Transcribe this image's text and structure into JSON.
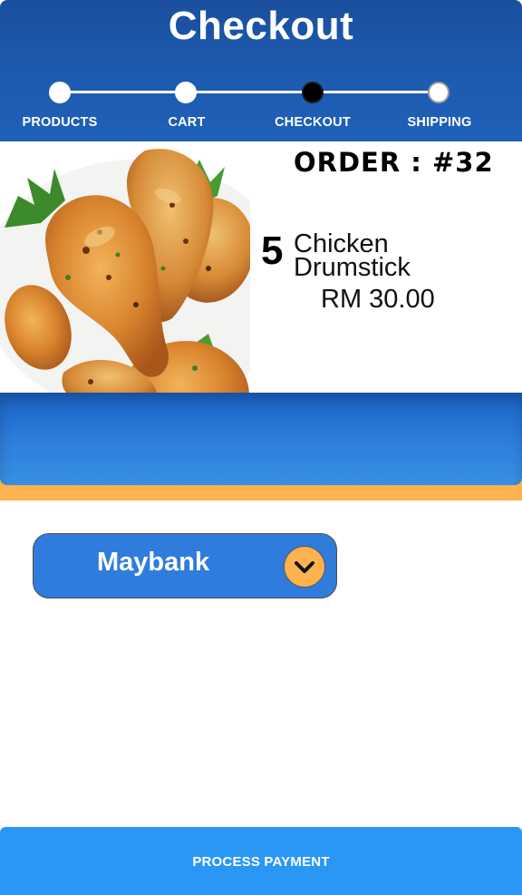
{
  "header": {
    "title": "Checkout"
  },
  "stepper": {
    "steps": [
      {
        "label": "PRODUCTS",
        "state": "done"
      },
      {
        "label": "CART",
        "state": "done"
      },
      {
        "label": "CHECKOUT",
        "state": "current"
      },
      {
        "label": "SHIPPING",
        "state": "pending"
      }
    ]
  },
  "order": {
    "title": "ORDER : #32",
    "quantity": "5",
    "item_name": "Chicken Drumstick",
    "price": "RM 30.00",
    "image_icon": "chicken-drumstick-photo"
  },
  "payment": {
    "bank_selected": "Maybank",
    "dropdown_icon": "chevron-down-icon",
    "process_label": "PROCESS PAYMENT"
  },
  "colors": {
    "header_blue": "#1d5bb0",
    "band_blue": "#2e7fda",
    "accent_orange": "#fdb24f",
    "select_blue": "#2f7cdc",
    "button_blue": "#2b97f5",
    "current_step": "#000000"
  }
}
